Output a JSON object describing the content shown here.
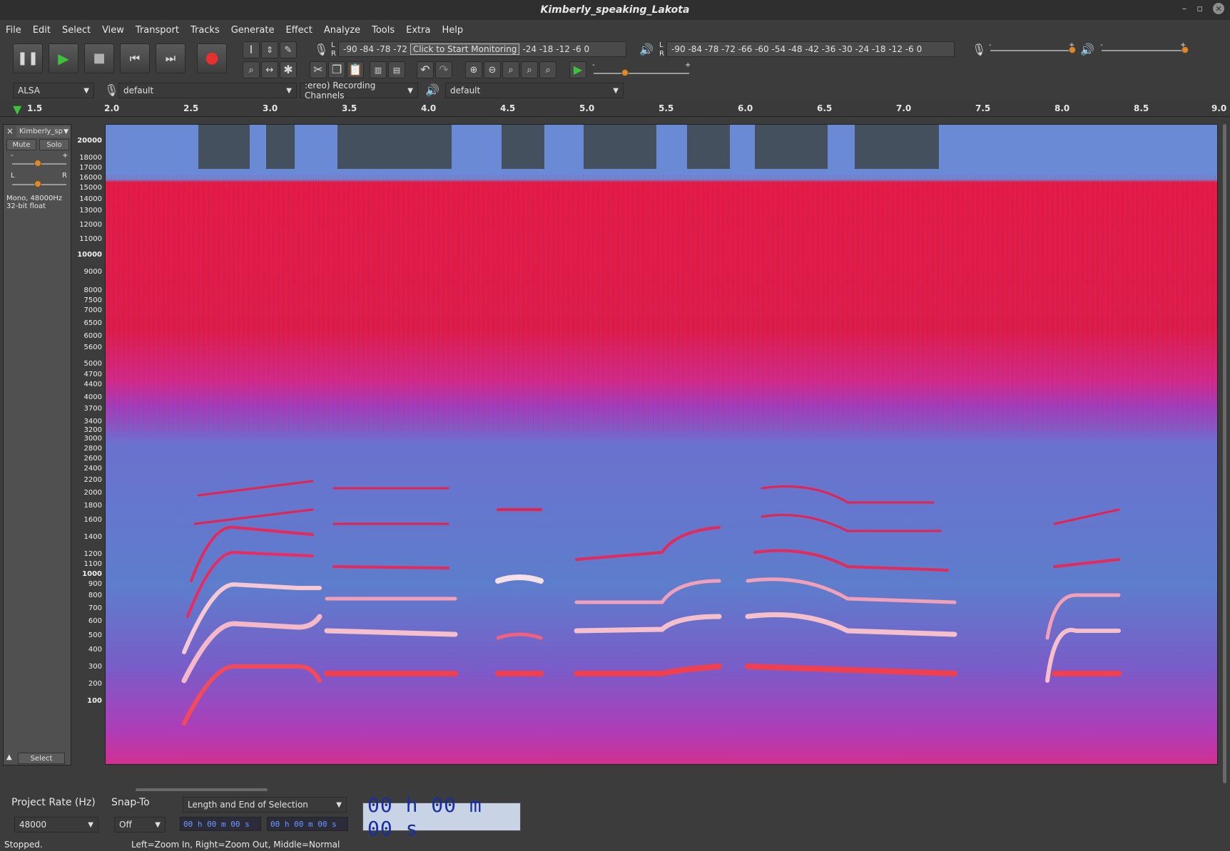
{
  "window": {
    "title": "Kimberly_speaking_Lakota"
  },
  "menu": [
    "File",
    "Edit",
    "Select",
    "View",
    "Transport",
    "Tracks",
    "Generate",
    "Effect",
    "Analyze",
    "Tools",
    "Extra",
    "Help"
  ],
  "meters": {
    "record_scale": "-90 -84 -78 -72",
    "record_tooltip": "Click to Start Monitoring",
    "record_scale_tail": "-24 -18 -12 -6 0",
    "playback_scale": "-90 -84 -78 -72 -66 -60 -54 -48 -42 -36 -30 -24 -18 -12 -6 0",
    "lr_l": "L",
    "lr_r": "R",
    "slider_minus": "-",
    "slider_plus": "+"
  },
  "device": {
    "host": "ALSA",
    "recording_device": "default",
    "channels": ":ereo) Recording Channels",
    "playback_device": "default"
  },
  "ruler": {
    "ticks": [
      "1.5",
      "2.0",
      "2.5",
      "3.0",
      "3.5",
      "4.0",
      "4.5",
      "5.0",
      "5.5",
      "6.0",
      "6.5",
      "7.0",
      "7.5",
      "8.0",
      "8.5",
      "9.0"
    ]
  },
  "track": {
    "name": "Kimberly_sp",
    "mute": "Mute",
    "solo": "Solo",
    "gain_minus": "-",
    "gain_plus": "+",
    "pan_l": "L",
    "pan_r": "R",
    "info_line1": "Mono, 48000Hz",
    "info_line2": "32-bit float",
    "select": "Select",
    "close": "×"
  },
  "freq_axis": [
    {
      "label": "20000",
      "bold": true
    },
    {
      "label": "18000"
    },
    {
      "label": "17000"
    },
    {
      "label": "16000"
    },
    {
      "label": "15000"
    },
    {
      "label": "14000"
    },
    {
      "label": "13000"
    },
    {
      "label": "12000"
    },
    {
      "label": "11000"
    },
    {
      "label": "10000",
      "bold": true
    },
    {
      "label": "9000"
    },
    {
      "label": "8000"
    },
    {
      "label": "7500"
    },
    {
      "label": "7000"
    },
    {
      "label": "6500"
    },
    {
      "label": "6000"
    },
    {
      "label": "5600"
    },
    {
      "label": "5000"
    },
    {
      "label": "4700"
    },
    {
      "label": "4400"
    },
    {
      "label": "4000"
    },
    {
      "label": "3700"
    },
    {
      "label": "3400"
    },
    {
      "label": "3200"
    },
    {
      "label": "3000"
    },
    {
      "label": "2800"
    },
    {
      "label": "2600"
    },
    {
      "label": "2400"
    },
    {
      "label": "2200"
    },
    {
      "label": "2000"
    },
    {
      "label": "1800"
    },
    {
      "label": "1600"
    },
    {
      "label": "1400"
    },
    {
      "label": "1200"
    },
    {
      "label": "1100"
    },
    {
      "label": "1000",
      "bold": true
    },
    {
      "label": "900"
    },
    {
      "label": "800"
    },
    {
      "label": "700"
    },
    {
      "label": "600"
    },
    {
      "label": "500"
    },
    {
      "label": "400"
    },
    {
      "label": "300"
    },
    {
      "label": "200"
    },
    {
      "label": "100",
      "bold": true
    }
  ],
  "bottom": {
    "project_rate_label": "Project Rate (Hz)",
    "project_rate_value": "48000",
    "snap_to_label": "Snap-To",
    "snap_to_value": "Off",
    "selection_mode": "Length and End of Selection",
    "sel_start": "00 h 00 m 00 s",
    "sel_end": "00 h 00 m 00 s",
    "big_time": "00 h 00 m 00 s"
  },
  "status": {
    "state": "Stopped.",
    "hint": "Left=Zoom In, Right=Zoom Out, Middle=Normal"
  },
  "colors": {
    "spectro_low": "#5a7fd0",
    "spectro_mid": "#c233b6",
    "spectro_high": "#e0163a",
    "spectro_peak": "#f6e8ec",
    "accent_record": "#e53030",
    "accent_play": "#3cc23c",
    "slider_knob": "#d88a35"
  }
}
